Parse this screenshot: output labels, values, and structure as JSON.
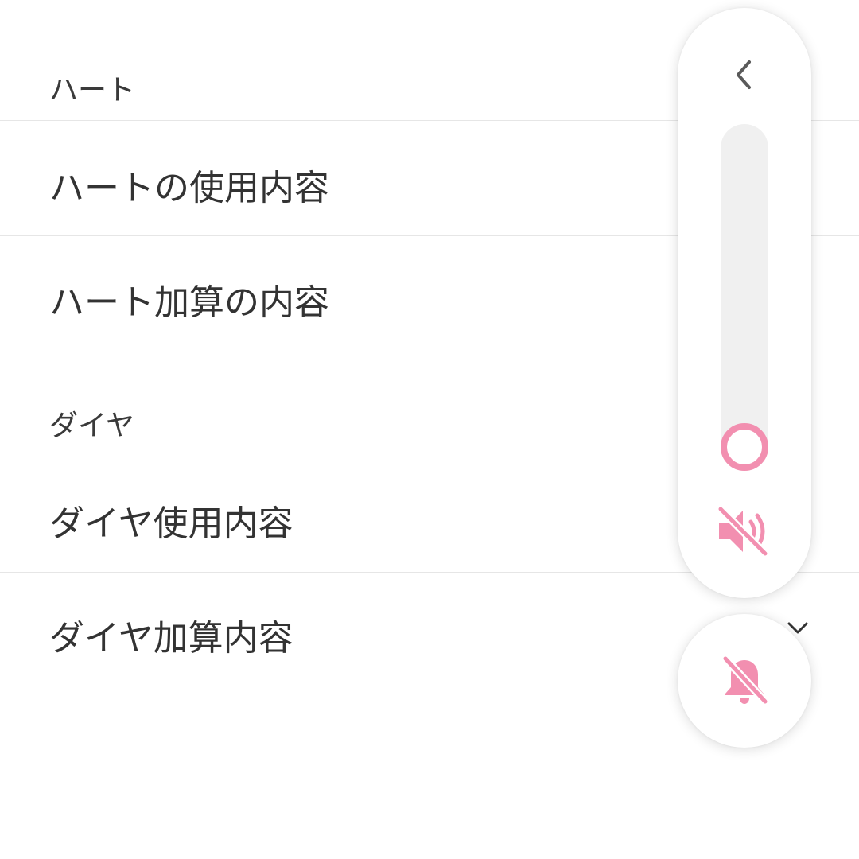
{
  "sections": [
    {
      "header": "ハート",
      "items": [
        {
          "label": "ハートの使用内容"
        },
        {
          "label": "ハート加算の内容"
        }
      ]
    },
    {
      "header": "ダイヤ",
      "items": [
        {
          "label": "ダイヤ使用内容"
        },
        {
          "label": "ダイヤ加算内容"
        }
      ]
    }
  ],
  "volume_panel": {
    "collapse_icon": "chevron-left-icon",
    "media_volume_level": 0.0,
    "media_volume_muted": true,
    "media_icon": "volume-off-icon",
    "ringer_icon": "bell-off-icon"
  },
  "colors": {
    "accent": "#f28fb0",
    "text": "#333333",
    "divider": "#e6e6e6",
    "track": "#f0f0f0"
  }
}
